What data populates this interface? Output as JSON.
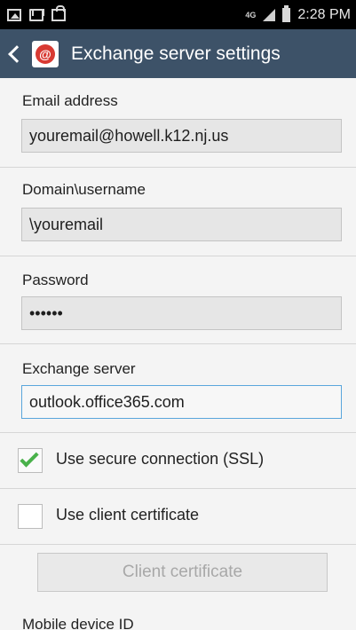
{
  "status_bar": {
    "icons": [
      "gallery-icon",
      "mail-icon",
      "bag-icon"
    ],
    "network": "4G",
    "time": "2:28 PM"
  },
  "header": {
    "title": "Exchange server settings",
    "back_icon": "chevron-left-icon",
    "app_icon": "email-app-icon",
    "app_glyph": "@"
  },
  "form": {
    "email": {
      "label": "Email address",
      "value": "youremail@howell.k12.nj.us"
    },
    "domain": {
      "label": "Domain\\username",
      "value": "\\youremail"
    },
    "password": {
      "label": "Password",
      "value": "••••••"
    },
    "server": {
      "label": "Exchange server",
      "value": "outlook.office365.com"
    },
    "ssl": {
      "label": "Use secure connection (SSL)",
      "checked": true
    },
    "client_cert": {
      "label": "Use client certificate",
      "checked": false
    },
    "cert_button": "Client certificate",
    "mobile_id_label": "Mobile device ID"
  },
  "colors": {
    "action_bar": "#3d5268",
    "check_accent": "#49b14a",
    "focused_border": "#5aa6dc"
  }
}
